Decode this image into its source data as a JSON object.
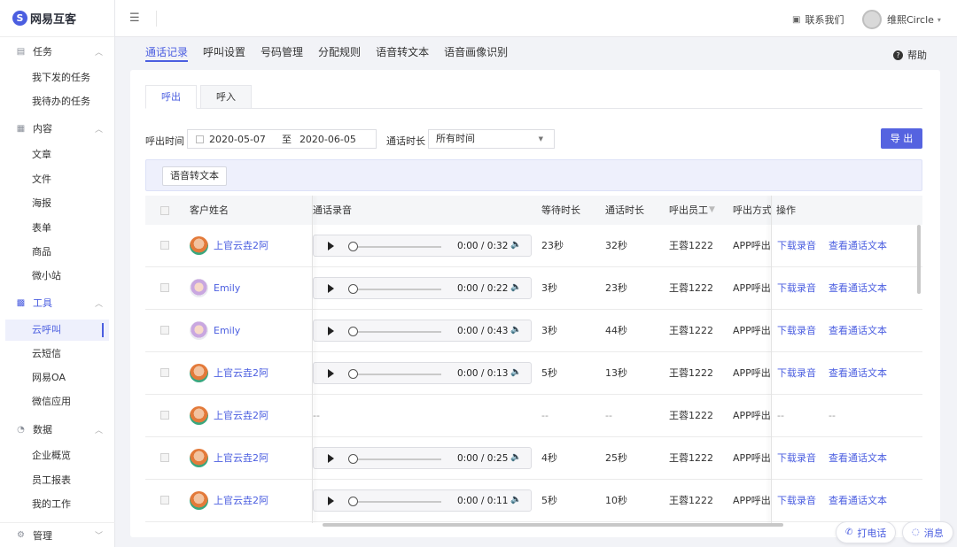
{
  "app": {
    "logo_mark": "S",
    "logo_text": "网易互客"
  },
  "sidebar": {
    "groups": [
      {
        "label": "任务",
        "icon": "clipboard-icon",
        "items": [
          "我下发的任务",
          "我待办的任务"
        ]
      },
      {
        "label": "内容",
        "icon": "document-icon",
        "items": [
          "文章",
          "文件",
          "海报",
          "表单",
          "商品",
          "微小站"
        ]
      },
      {
        "label": "工具",
        "icon": "grid-icon",
        "items": [
          "云呼叫",
          "云短信",
          "网易OA",
          "微信应用"
        ]
      },
      {
        "label": "数据",
        "icon": "pie-chart-icon",
        "items": [
          "企业概览",
          "员工报表",
          "我的工作"
        ]
      },
      {
        "label": "管理",
        "icon": "gear-icon",
        "items": []
      }
    ],
    "active_item": "云呼叫"
  },
  "topbar": {
    "contact_label": "联系我们",
    "user_name": "维熙Circle"
  },
  "subnav": {
    "tabs": [
      "通话记录",
      "呼叫设置",
      "号码管理",
      "分配规则",
      "语音转文本",
      "语音画像识别"
    ],
    "active": "通话记录",
    "help_label": "帮助"
  },
  "direction_tabs": [
    "呼出",
    "呼入"
  ],
  "filters": {
    "time_label": "呼出时间",
    "start_date": "2020-05-07",
    "range_sep": "至",
    "end_date": "2020-06-05",
    "duration_label": "通话时长",
    "duration_value": "所有时间",
    "export_label": "导 出"
  },
  "toolbar": {
    "speech_to_text_label": "语音转文本"
  },
  "table": {
    "headers": {
      "customer": "客户姓名",
      "recording": "通话录音",
      "wait": "等待时长",
      "talk": "通话时长",
      "staff": "呼出员工",
      "method": "呼出方式",
      "ops": "操作"
    },
    "rows": [
      {
        "name": "上官云垚2阿",
        "avatar": "a",
        "audio": "0:00 / 0:32",
        "wait": "23秒",
        "talk": "32秒",
        "staff": "王蓉1222",
        "method": "APP呼出",
        "op1": "下载录音",
        "op2": "查看通话文本"
      },
      {
        "name": "Emily",
        "avatar": "b",
        "audio": "0:00 / 0:22",
        "wait": "3秒",
        "talk": "23秒",
        "staff": "王蓉1222",
        "method": "APP呼出",
        "op1": "下载录音",
        "op2": "查看通话文本"
      },
      {
        "name": "Emily",
        "avatar": "b",
        "audio": "0:00 / 0:43",
        "wait": "3秒",
        "talk": "44秒",
        "staff": "王蓉1222",
        "method": "APP呼出",
        "op1": "下载录音",
        "op2": "查看通话文本"
      },
      {
        "name": "上官云垚2阿",
        "avatar": "a",
        "audio": "0:00 / 0:13",
        "wait": "5秒",
        "talk": "13秒",
        "staff": "王蓉1222",
        "method": "APP呼出",
        "op1": "下载录音",
        "op2": "查看通话文本"
      },
      {
        "name": "上官云垚2阿",
        "avatar": "a",
        "audio": "",
        "recording_text": "--",
        "wait": "--",
        "talk": "--",
        "staff": "王蓉1222",
        "method": "APP呼出",
        "op1": "--",
        "op2": "--"
      },
      {
        "name": "上官云垚2阿",
        "avatar": "a",
        "audio": "0:00 / 0:25",
        "wait": "4秒",
        "talk": "25秒",
        "staff": "王蓉1222",
        "method": "APP呼出",
        "op1": "下载录音",
        "op2": "查看通话文本"
      },
      {
        "name": "上官云垚2阿",
        "avatar": "a",
        "audio": "0:00 / 0:11",
        "wait": "5秒",
        "talk": "10秒",
        "staff": "王蓉1222",
        "method": "APP呼出",
        "op1": "下载录音",
        "op2": "查看通话文本"
      }
    ]
  },
  "float_buttons": {
    "call_label": "打电话",
    "message_label": "消息"
  },
  "colors": {
    "accent": "#4b5ee0",
    "export": "#5563e0",
    "background": "#f2f3f7"
  }
}
